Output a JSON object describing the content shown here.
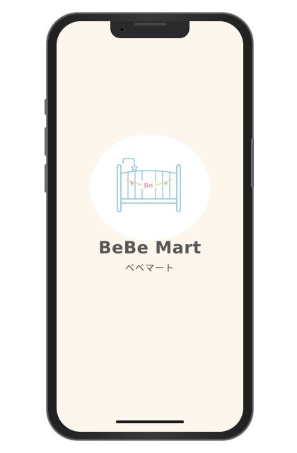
{
  "app": {
    "brand_name": "BeBe Mart",
    "brand_kana": "ベベマート",
    "logo_badge_text": "Be"
  },
  "icons": {
    "logo": "crib-icon",
    "notch": "camera-notch"
  },
  "colors": {
    "screen_background": "#fdf6ec",
    "brand_text": "#565656",
    "crib_stroke": "#8cc6e6",
    "badge_pink": "#f4a0b0",
    "badge_yellow": "#f6d56a"
  }
}
